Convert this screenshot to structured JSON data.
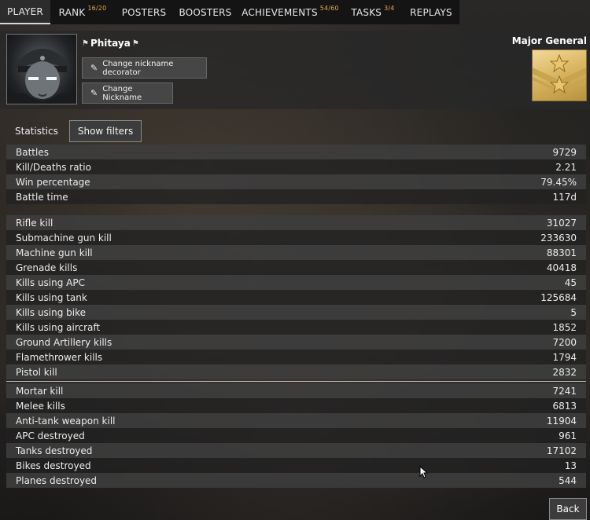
{
  "tabs": [
    {
      "label": "PLAYER",
      "badge": ""
    },
    {
      "label": "RANK",
      "badge": "16/20"
    },
    {
      "label": "POSTERS",
      "badge": ""
    },
    {
      "label": "BOOSTERS",
      "badge": ""
    },
    {
      "label": "ACHIEVEMENTS",
      "badge": "54/60"
    },
    {
      "label": "TASKS",
      "badge": "3/4"
    },
    {
      "label": "REPLAYS",
      "badge": ""
    }
  ],
  "profile": {
    "nickname": "Phitaya",
    "change_decorator_label": "Change nickname decorator",
    "change_nickname_label": "Change Nickname",
    "rank_title": "Major General"
  },
  "statistics": {
    "title": "Statistics",
    "filters_label": "Show filters"
  },
  "groups": [
    [
      {
        "label": "Battles",
        "value": "9729"
      },
      {
        "label": "Kill/Deaths ratio",
        "value": "2.21"
      },
      {
        "label": "Win percentage",
        "value": "79.45%"
      },
      {
        "label": "Battle time",
        "value": "117d"
      }
    ],
    [
      {
        "label": "Rifle kill",
        "value": "31027"
      },
      {
        "label": "Submachine gun kill",
        "value": "233630"
      },
      {
        "label": "Machine gun kill",
        "value": "88301"
      },
      {
        "label": "Grenade kills",
        "value": "40418"
      },
      {
        "label": "Kills using APC",
        "value": "45"
      },
      {
        "label": "Kills using tank",
        "value": "125684"
      },
      {
        "label": "Kills using bike",
        "value": "5"
      },
      {
        "label": "Kills using aircraft",
        "value": "1852"
      },
      {
        "label": "Ground Artillery kills",
        "value": "7200"
      },
      {
        "label": "Flamethrower kills",
        "value": "1794"
      },
      {
        "label": "Pistol kill",
        "value": "2832"
      }
    ],
    [
      {
        "label": "Mortar kill",
        "value": "7241"
      },
      {
        "label": "Melee kills",
        "value": "6813"
      },
      {
        "label": "Anti-tank weapon kill",
        "value": "11904"
      },
      {
        "label": "APC destroyed",
        "value": "961"
      },
      {
        "label": "Tanks destroyed",
        "value": "17102"
      },
      {
        "label": "Bikes destroyed",
        "value": "13"
      },
      {
        "label": "Planes destroyed",
        "value": "544"
      }
    ]
  ],
  "back_label": "Back",
  "icons": {
    "edit": "pencil-icon",
    "decorator": "flag-icon",
    "rank": "star-icon"
  }
}
